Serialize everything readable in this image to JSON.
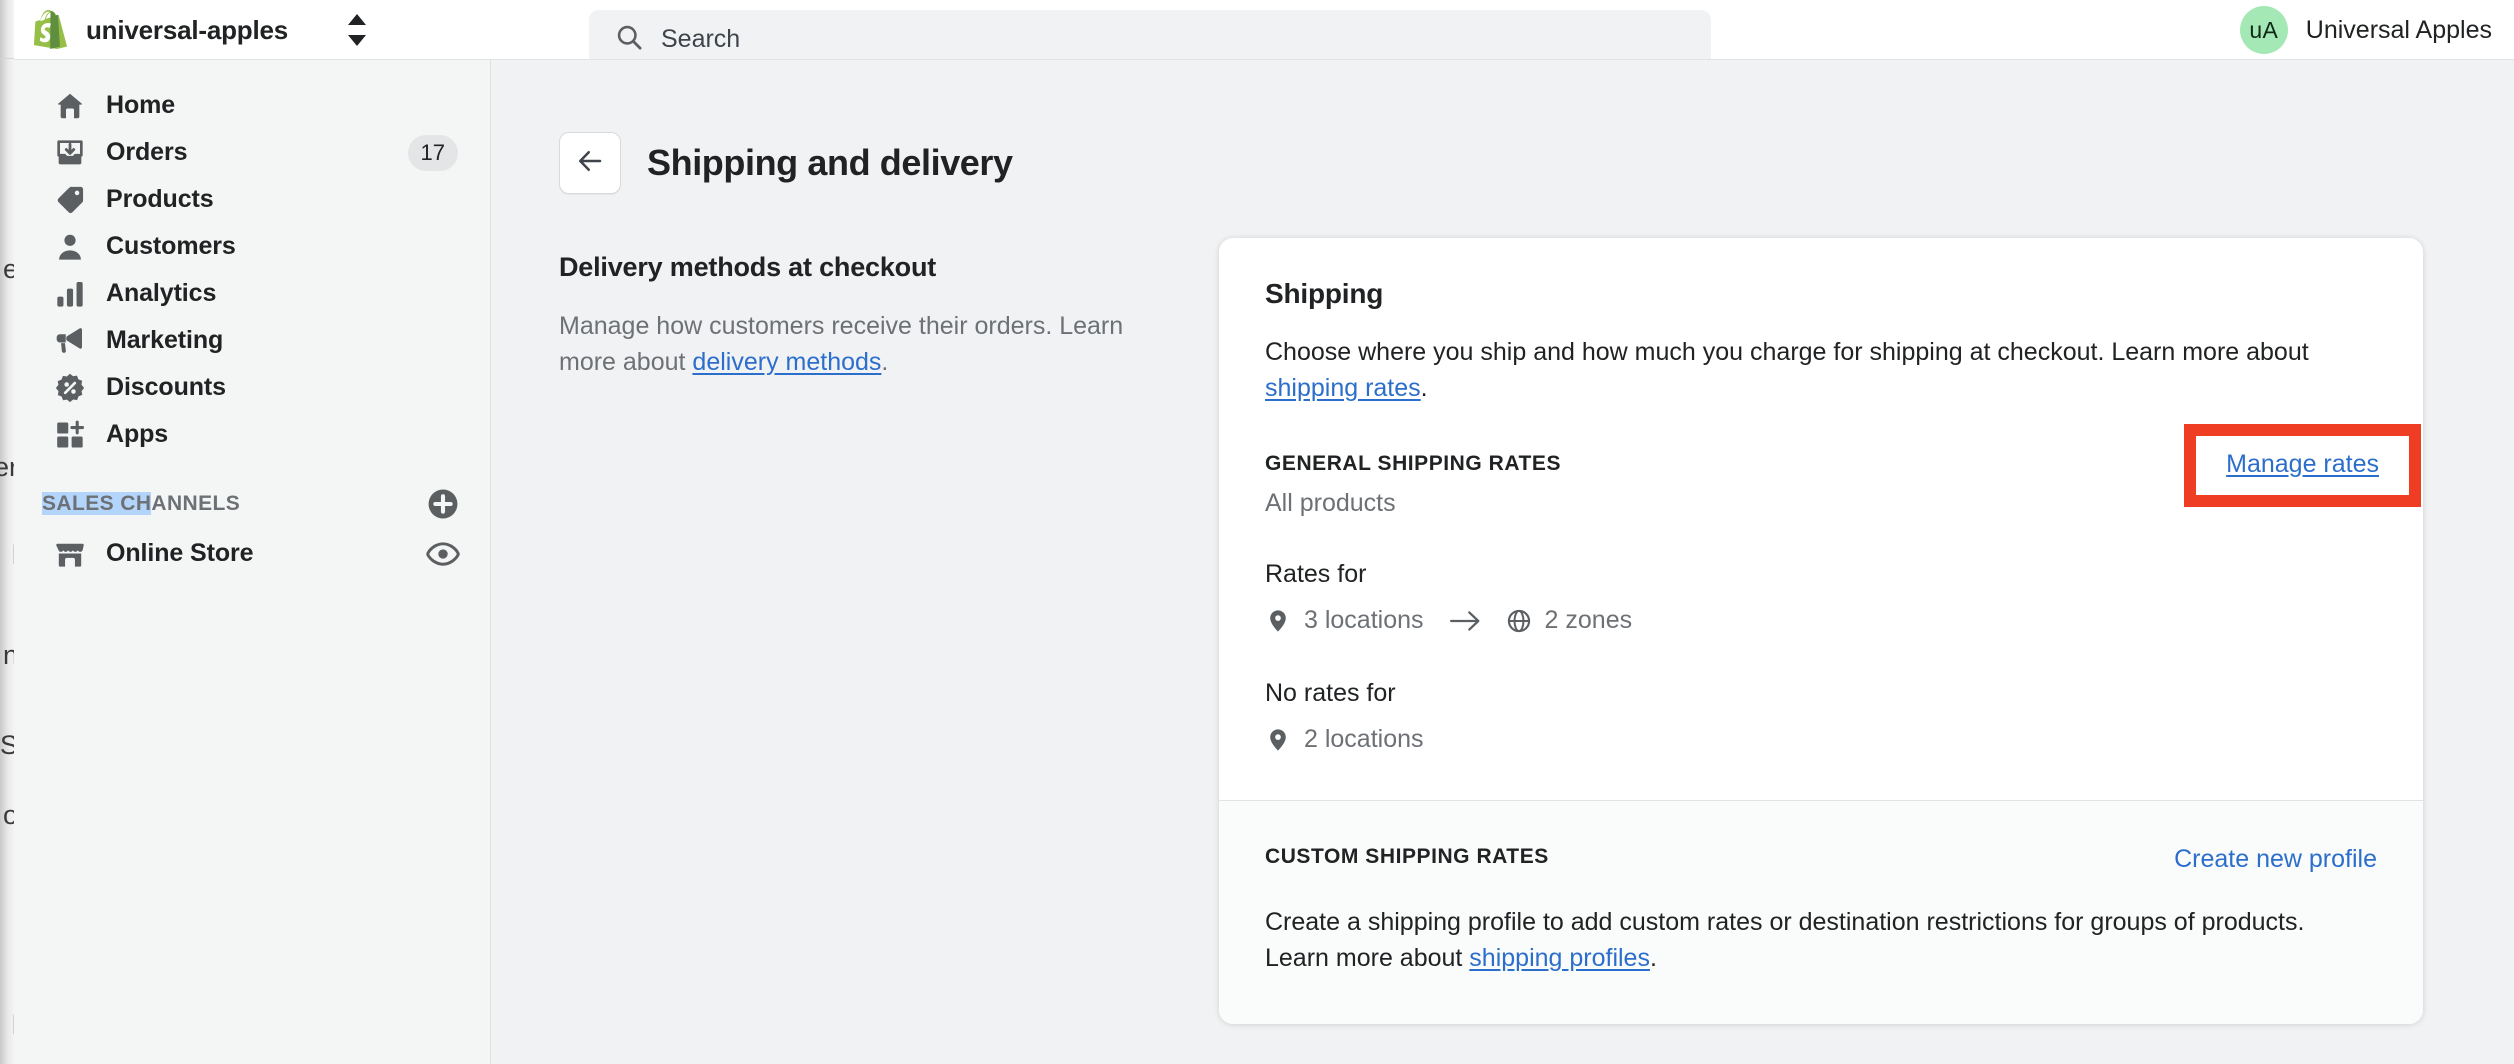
{
  "topbar": {
    "logo_icon": "shopify-bag-logo",
    "store_name": "universal-apples",
    "store_switcher_icon": "chevron-up-down-icon",
    "search": {
      "icon": "search-icon",
      "placeholder": "Search",
      "value": ""
    },
    "account": {
      "avatar_initials": "uA",
      "avatar_color": "#a4e8b5",
      "name": "Universal Apples"
    }
  },
  "sidebar": {
    "items": [
      {
        "label": "Home",
        "icon": "home-icon",
        "badge": ""
      },
      {
        "label": "Orders",
        "icon": "orders-inbox-icon",
        "badge": "17"
      },
      {
        "label": "Products",
        "icon": "product-tag-icon",
        "badge": ""
      },
      {
        "label": "Customers",
        "icon": "customer-person-icon",
        "badge": ""
      },
      {
        "label": "Analytics",
        "icon": "analytics-bars-icon",
        "badge": ""
      },
      {
        "label": "Marketing",
        "icon": "marketing-megaphone-icon",
        "badge": ""
      },
      {
        "label": "Discounts",
        "icon": "discount-percent-badge-icon",
        "badge": ""
      },
      {
        "label": "Apps",
        "icon": "apps-grid-plus-icon",
        "badge": ""
      }
    ],
    "section": {
      "title_selected": "SALES CH",
      "title_rest": "ANNELS",
      "add_icon": "plus-circle-icon"
    },
    "channels": [
      {
        "label": "Online Store",
        "icon": "storefront-icon",
        "action_icon": "eye-icon"
      }
    ]
  },
  "page": {
    "back_icon": "arrow-left-icon",
    "title": "Shipping and delivery"
  },
  "left_column": {
    "heading": "Delivery methods at checkout",
    "body_before": "Manage how customers receive their orders. Learn more about ",
    "link": "delivery methods",
    "body_after": "."
  },
  "card": {
    "heading": "Shipping",
    "body_before": "Choose where you ship and how much you charge for shipping at checkout. Learn more about ",
    "link": "shipping rates",
    "body_after": ".",
    "general": {
      "eyebrow": "GENERAL SHIPPING RATES",
      "subtitle": "All products",
      "action_label": "Manage rates",
      "rates_for_label": "Rates for",
      "locations_icon": "map-pin-icon",
      "locations": "3 locations",
      "arrow_icon": "arrow-right-icon",
      "zones_icon": "globe-icon",
      "zones": "2 zones",
      "no_rates_label": "No rates for",
      "no_rates_icon": "map-pin-icon",
      "no_rates_locations": "2 locations"
    },
    "custom": {
      "eyebrow": "CUSTOM SHIPPING RATES",
      "action_label": "Create new profile",
      "body_before": "Create a shipping profile to add custom rates or destination restrictions for groups of products. Learn more about ",
      "link": "shipping profiles",
      "body_after": "."
    }
  },
  "annotation": {
    "target": "Manage rates",
    "color": "#ef3d23"
  },
  "colors": {
    "page_background": "#f1f2f3",
    "sidebar_background": "#f4f5f5",
    "card_background": "#ffffff",
    "link_blue": "#2c6ecb",
    "text_primary": "#202223",
    "text_subdued": "#6d7175",
    "badge_background": "#e4e5e7",
    "selection_blue": "#b4d5fb"
  }
}
